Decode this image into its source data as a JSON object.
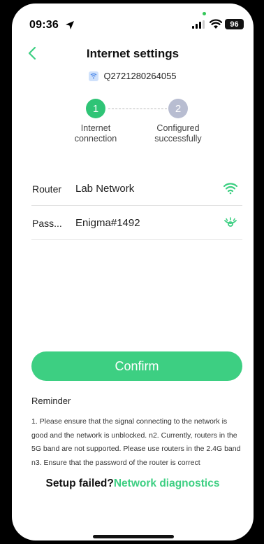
{
  "status_bar": {
    "time": "09:36",
    "battery": "96"
  },
  "header": {
    "title": "Internet settings"
  },
  "device": {
    "id": "Q2721280264055"
  },
  "steps": [
    {
      "number": "1",
      "label_line1": "Internet",
      "label_line2": "connection",
      "state": "active"
    },
    {
      "number": "2",
      "label_line1": "Configured",
      "label_line2": "successfully",
      "state": "pending"
    }
  ],
  "form": {
    "router_label": "Router",
    "router_value": "Lab Network",
    "password_label": "Pass...",
    "password_value": "Enigma#1492"
  },
  "confirm_label": "Confirm",
  "reminder": {
    "title": "Reminder",
    "text": "1. Please ensure that the signal connecting to the network is good and the network is unblocked. n2. Currently, routers in the 5G band are not supported. Please use routers in the 2.4G band n3. Ensure that the password of the router is correct"
  },
  "footer": {
    "failed_text": "Setup failed?",
    "diagnostics_link": "Network diagnostics"
  },
  "colors": {
    "accent": "#3dcf82",
    "step_active": "#2fc476",
    "step_pending": "#b8bdd1"
  },
  "icons": [
    "location-arrow-icon",
    "cellular-signal-icon",
    "wifi-status-icon",
    "back-chevron-icon",
    "device-wifi-icon",
    "wifi-icon",
    "eye-closed-icon"
  ]
}
